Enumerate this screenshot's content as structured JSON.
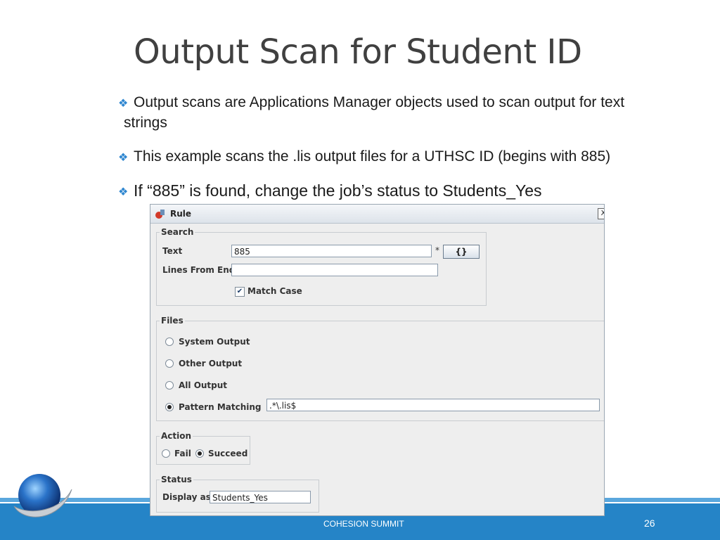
{
  "slide": {
    "title": "Output Scan for Student ID",
    "bullets": [
      {
        "line1": "Output scans are Applications Manager objects used to scan output for text",
        "line2": "strings"
      },
      {
        "line1": "This example scans the .lis output files for a UTHSC ID (begins with 885)"
      },
      {
        "line1": "If “885” is found, change the job’s status to Students_Yes"
      }
    ],
    "bullet_icon": "diamond-bullet-icon",
    "footer": "COHESION SUMMIT",
    "page_number": "26",
    "accent_color": "#2584c7"
  },
  "dialog": {
    "title": "Rule",
    "close_glyph": "X",
    "search": {
      "legend": "Search",
      "text_label": "Text",
      "text_value": "885",
      "required_mark": "*",
      "var_button": "{}",
      "lines_label": "Lines From End",
      "lines_value": "",
      "match_case_label": "Match Case",
      "match_case_checked": true
    },
    "files": {
      "legend": "Files",
      "options": [
        "System Output",
        "Other Output",
        "All Output",
        "Pattern Matching"
      ],
      "selected": "Pattern Matching",
      "pattern_value": ".*\\.lis$"
    },
    "action": {
      "legend": "Action",
      "options": [
        "Fail",
        "Succeed"
      ],
      "selected": "Succeed"
    },
    "status": {
      "legend": "Status",
      "display_label": "Display as",
      "display_value": "Students_Yes"
    }
  }
}
